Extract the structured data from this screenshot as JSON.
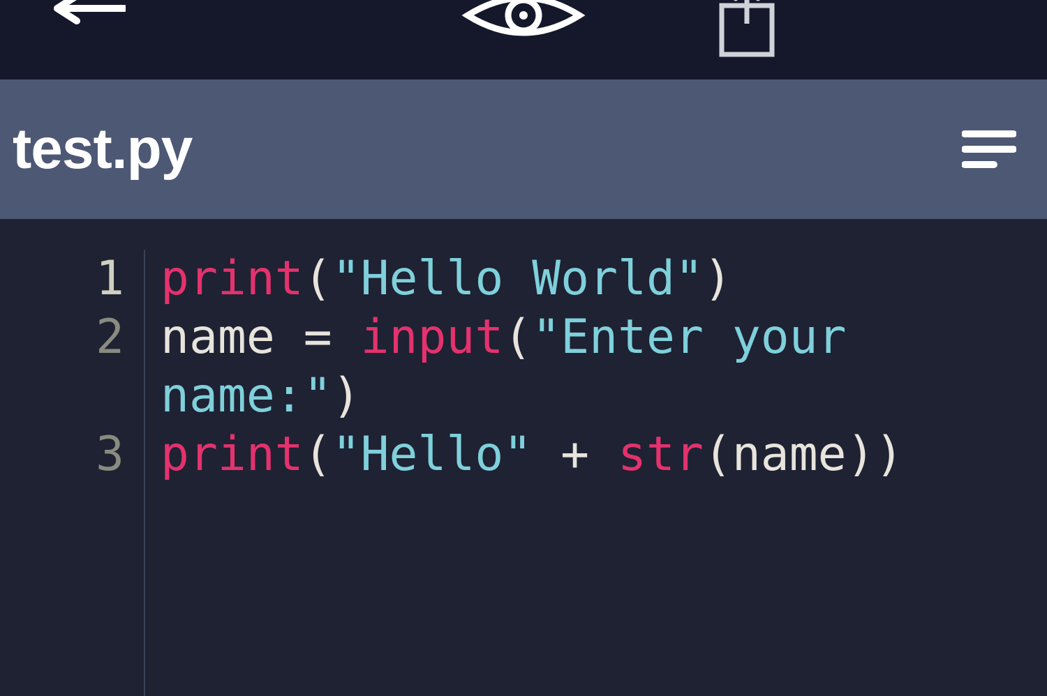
{
  "toolbar": {
    "back_icon": "back-arrow-icon",
    "center_icon": "eye-icon",
    "share_icon": "share-icon"
  },
  "filebar": {
    "filename": "test.py",
    "menu_icon": "list-icon"
  },
  "syntax_colors": {
    "function": "#e3326d",
    "string": "#7fd0db",
    "default": "#e8e4dc"
  },
  "editor": {
    "active_line": 1,
    "lines": [
      {
        "n": 1,
        "tokens": [
          {
            "t": "print",
            "c": "fn"
          },
          {
            "t": "(",
            "c": "pun"
          },
          {
            "t": "\"Hello World\"",
            "c": "str"
          },
          {
            "t": ")",
            "c": "pun"
          }
        ]
      },
      {
        "n": 2,
        "tokens": [
          {
            "t": "name ",
            "c": "id"
          },
          {
            "t": "= ",
            "c": "pun"
          },
          {
            "t": "input",
            "c": "fn"
          },
          {
            "t": "(",
            "c": "pun"
          },
          {
            "t": "\"Enter your ",
            "c": "str"
          }
        ],
        "wrap_tokens": [
          {
            "t": "name:\"",
            "c": "str"
          },
          {
            "t": ")",
            "c": "pun"
          }
        ]
      },
      {
        "n": 3,
        "tokens": [
          {
            "t": "print",
            "c": "fn"
          },
          {
            "t": "(",
            "c": "pun"
          },
          {
            "t": "\"Hello\"",
            "c": "str"
          },
          {
            "t": " + ",
            "c": "pun"
          },
          {
            "t": "str",
            "c": "fn"
          },
          {
            "t": "(",
            "c": "pun"
          },
          {
            "t": "name",
            "c": "id"
          },
          {
            "t": "))",
            "c": "pun"
          }
        ]
      }
    ]
  }
}
